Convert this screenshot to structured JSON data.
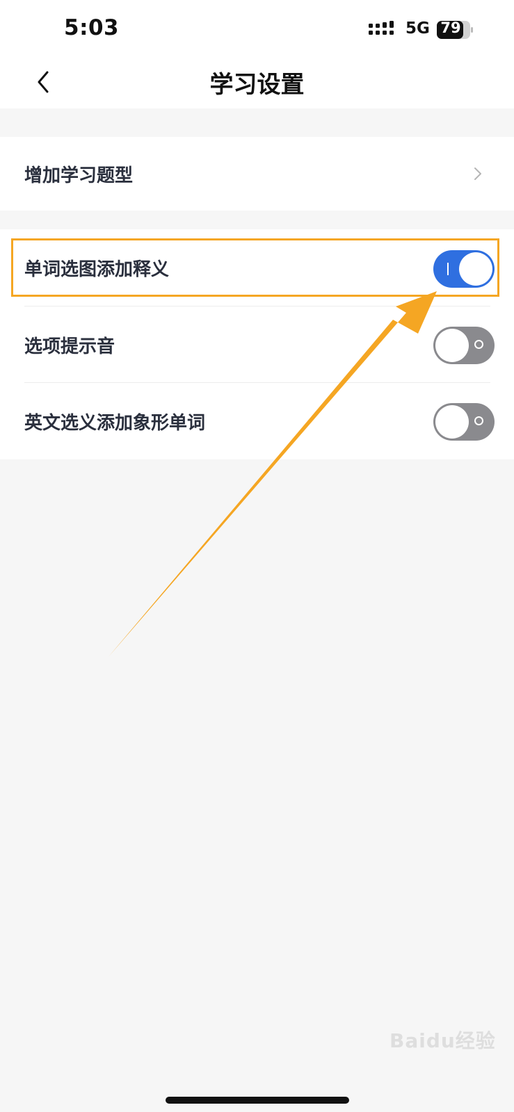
{
  "status_bar": {
    "time": "5:03",
    "network": "5G",
    "battery": "79"
  },
  "nav": {
    "title": "学习设置",
    "back_icon": "chevron-left-icon"
  },
  "settings": {
    "add_question_types": {
      "label": "增加学习题型",
      "icon": "chevron-right-icon"
    },
    "toggles": [
      {
        "label": "单词选图添加释义",
        "on": true
      },
      {
        "label": "选项提示音",
        "on": false
      },
      {
        "label": "英文选义添加象形单词",
        "on": false
      }
    ]
  },
  "annotation": {
    "highlight_color": "#f5a623"
  },
  "watermark": "Baidu经验",
  "colors": {
    "toggle_on": "#2f6fe0",
    "toggle_off": "#8a8a8e",
    "background": "#f6f6f6"
  }
}
